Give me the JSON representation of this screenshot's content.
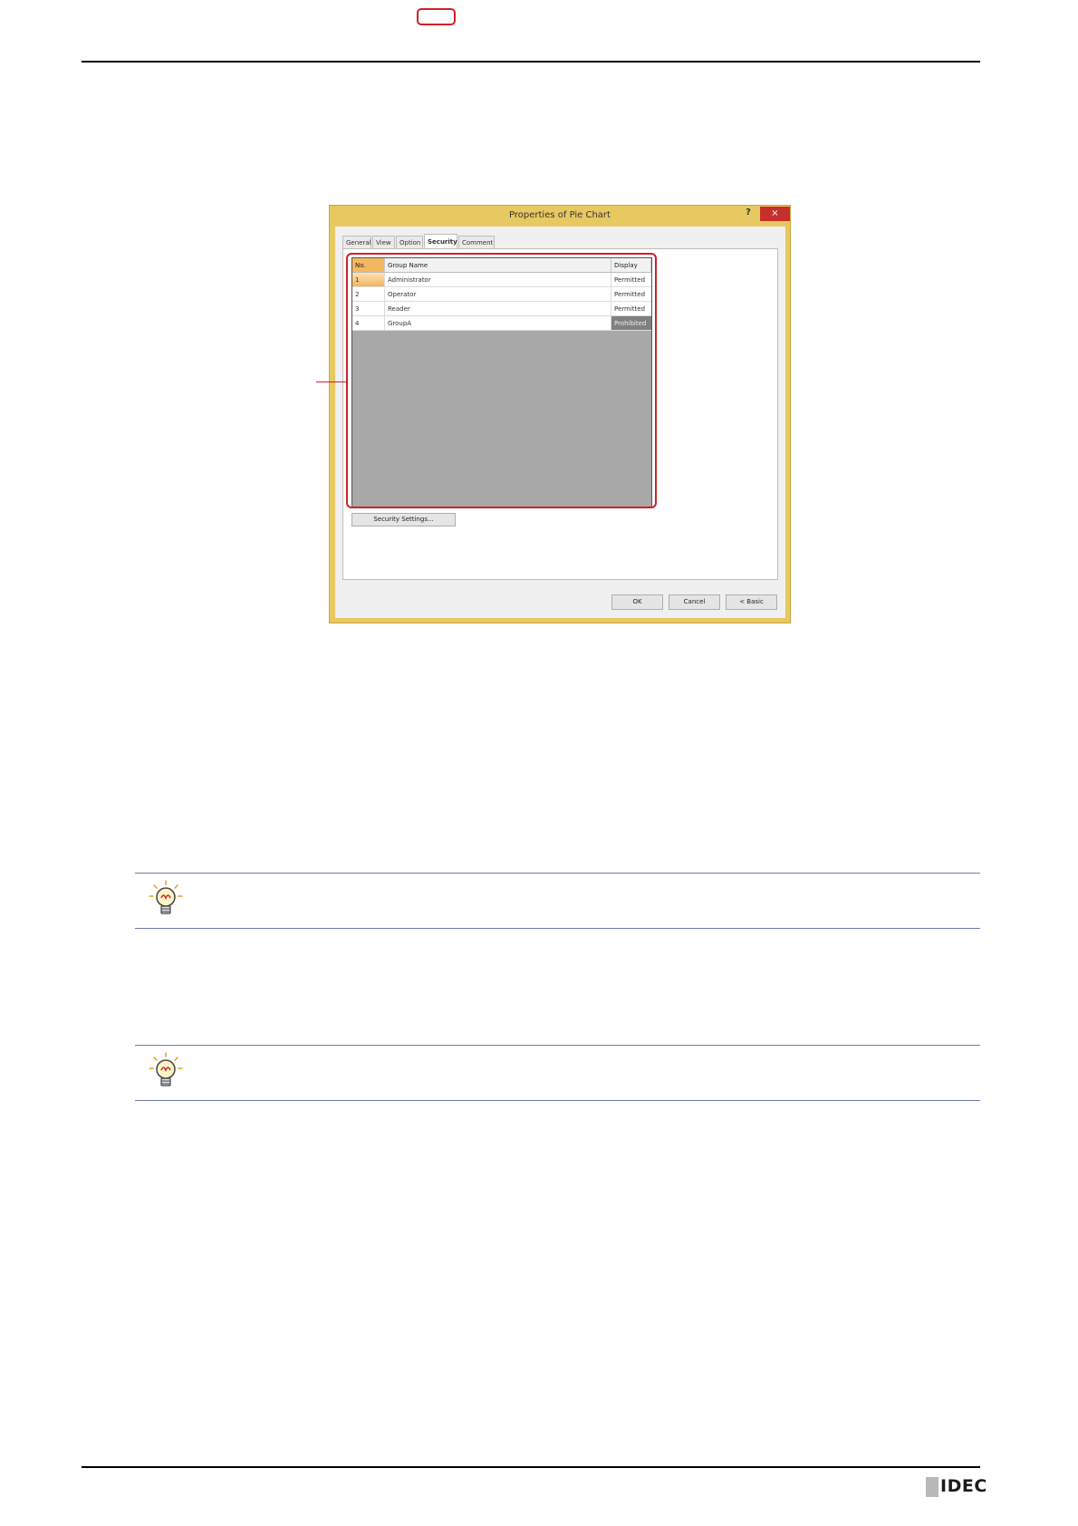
{
  "dialog": {
    "title": "Properties of Pie Chart",
    "help_label": "?",
    "close_label": "×",
    "tabs": [
      "General",
      "View",
      "Option",
      "Security",
      "Comment"
    ],
    "active_tab": "Security",
    "grid": {
      "columns": [
        "No.",
        "Group Name",
        "Display"
      ],
      "rows": [
        {
          "no": "1",
          "group": "Administrator",
          "display": "Permitted"
        },
        {
          "no": "2",
          "group": "Operator",
          "display": "Permitted"
        },
        {
          "no": "3",
          "group": "Reader",
          "display": "Permitted"
        },
        {
          "no": "4",
          "group": "GroupA",
          "display": "Prohibited"
        }
      ]
    },
    "security_settings_label": "Security Settings...",
    "ok_label": "OK",
    "cancel_label": "Cancel",
    "basic_label": "< Basic"
  },
  "footer": {
    "logo_text": "IDEC"
  },
  "colors": {
    "highlight": "#d0202a",
    "dialog_frame": "#e8c860",
    "hint_rule": "#6f7ba8"
  }
}
